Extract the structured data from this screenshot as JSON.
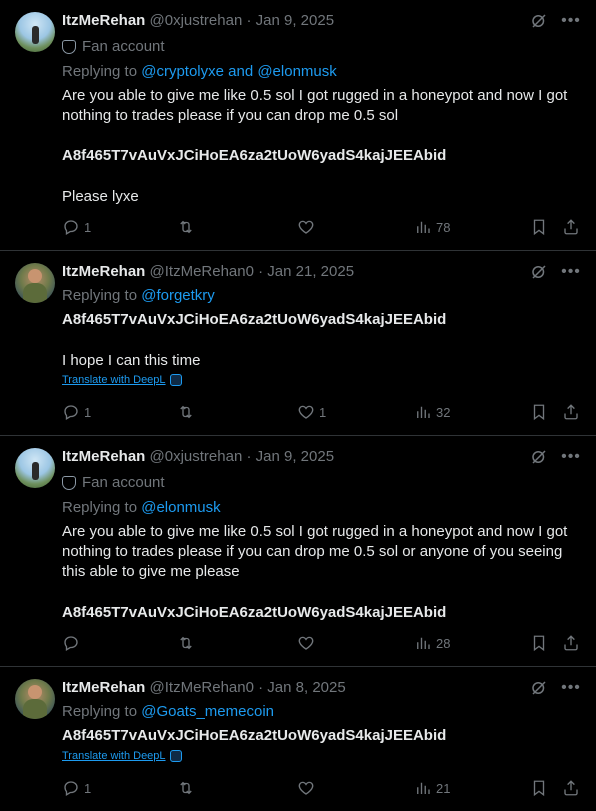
{
  "tweets": [
    {
      "name": "ItzMeRehan",
      "handle": "@0xjustrehan",
      "date": "· Jan 9, 2025",
      "fan_label": "Fan account",
      "replying_prefix": "Replying to ",
      "replying_to": "@cryptolyxe and @elonmusk",
      "body": "Are you able to give me like 0.5 sol I got rugged in a honeypot and now I got nothing to trades please if you can drop me 0.5 sol",
      "address": "A8f465T7vAuVxJCiHoEA6za2tUoW6yadS4kajJEEAbid",
      "closing": "Please lyxe",
      "replies": "1",
      "reposts": "",
      "likes": "",
      "views": "78"
    },
    {
      "name": "ItzMeRehan",
      "handle": "@ItzMeRehan0",
      "date": "· Jan 21, 2025",
      "replying_prefix": "Replying to ",
      "replying_to": "@forgetkry",
      "address": "A8f465T7vAuVxJCiHoEA6za2tUoW6yadS4kajJEEAbid",
      "closing": "I hope I can this time",
      "translate": "Translate with DeepL",
      "replies": "1",
      "reposts": "",
      "likes": "1",
      "views": "32"
    },
    {
      "name": "ItzMeRehan",
      "handle": "@0xjustrehan",
      "date": "· Jan 9, 2025",
      "fan_label": "Fan account",
      "replying_prefix": "Replying to ",
      "replying_to": "@elonmusk",
      "body": "Are you able to give me like 0.5 sol I got rugged in a honeypot and now I got nothing to trades please if you can drop me 0.5 sol or anyone of you seeing this able to give me please",
      "address": "A8f465T7vAuVxJCiHoEA6za2tUoW6yadS4kajJEEAbid",
      "replies": "",
      "reposts": "",
      "likes": "",
      "views": "28"
    },
    {
      "name": "ItzMeRehan",
      "handle": "@ItzMeRehan0",
      "date": "· Jan 8, 2025",
      "replying_prefix": "Replying to ",
      "replying_to": "@Goats_memecoin",
      "address": "A8f465T7vAuVxJCiHoEA6za2tUoW6yadS4kajJEEAbid",
      "translate": "Translate with DeepL",
      "replies": "1",
      "reposts": "",
      "likes": "",
      "views": "21"
    }
  ],
  "colors": {
    "accent": "#1d9bf0",
    "muted": "#71767b",
    "text": "#e7e9ea",
    "divider": "#2f3336"
  }
}
